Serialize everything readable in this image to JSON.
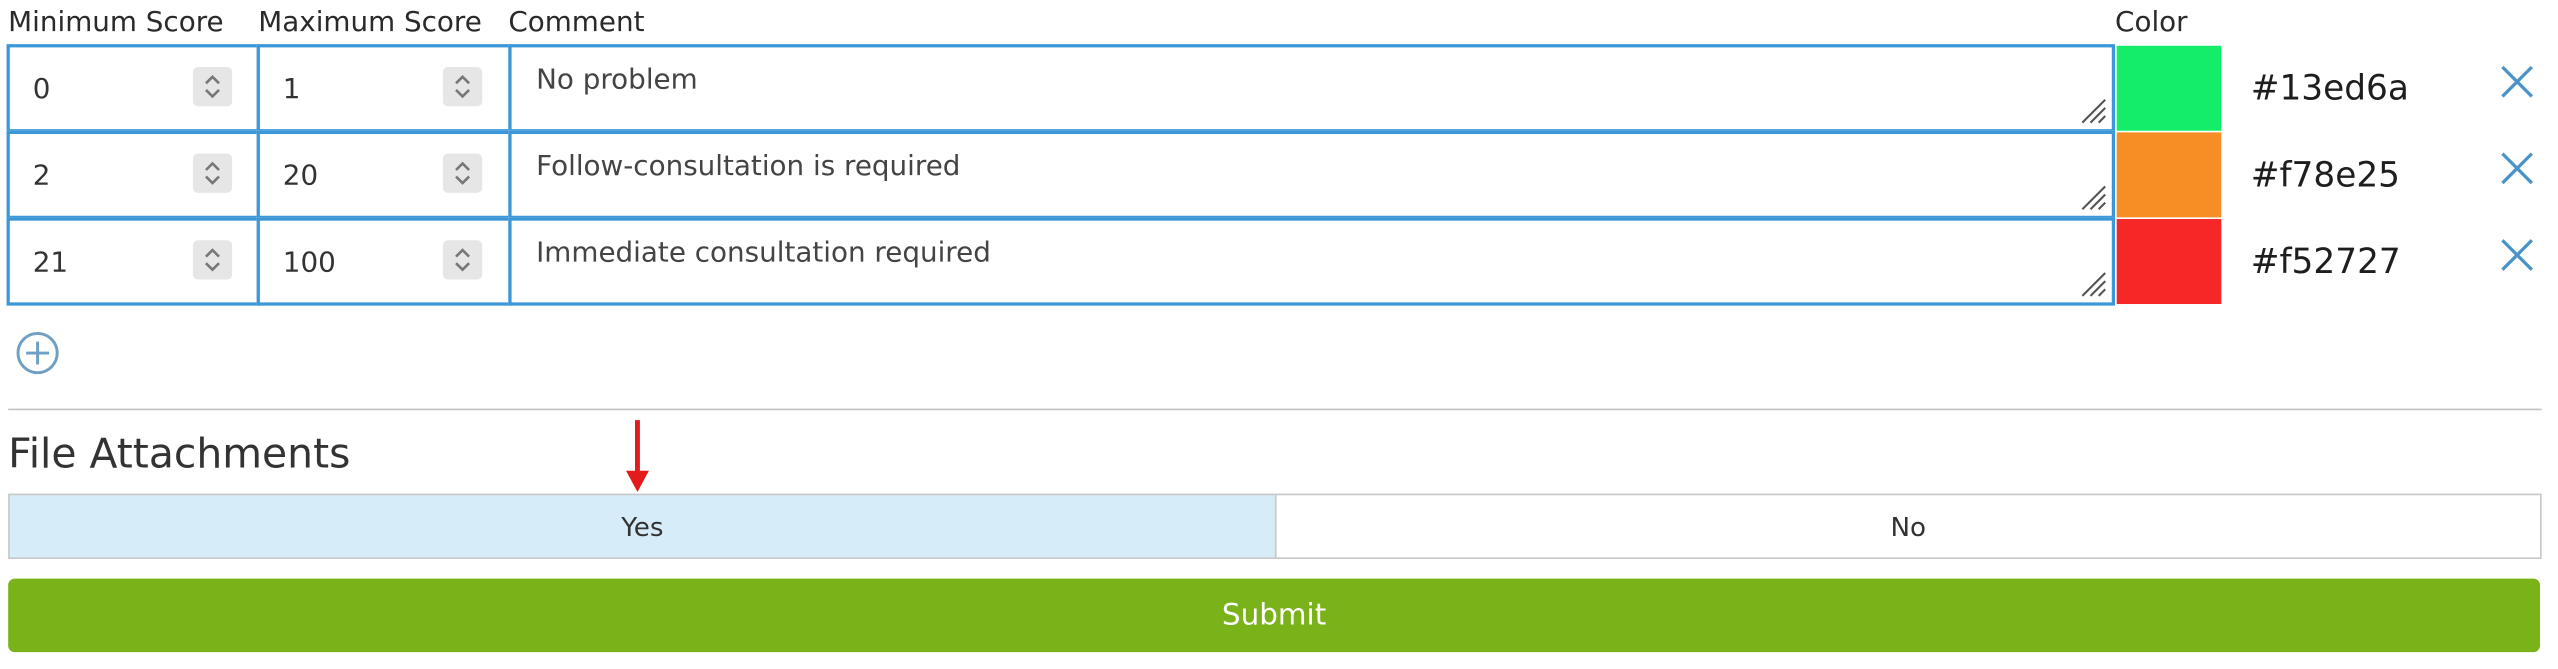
{
  "headers": {
    "min_score": "Minimum Score",
    "max_score": "Maximum Score",
    "comment": "Comment",
    "color": "Color"
  },
  "rows": [
    {
      "min": "0",
      "max": "1",
      "comment": "No problem",
      "color_hex": "#13ed6a"
    },
    {
      "min": "2",
      "max": "20",
      "comment": "Follow-consultation is required",
      "color_hex": "#f78e25"
    },
    {
      "min": "21",
      "max": "100",
      "comment": "Immediate consultation required",
      "color_hex": "#f52727"
    }
  ],
  "file_attachments": {
    "title": "File Attachments",
    "options": [
      "Yes",
      "No"
    ],
    "selected": "Yes"
  },
  "submit_label": "Submit",
  "colors": {
    "input_border": "#3c97d8",
    "selected_option_bg": "#d6ecf8",
    "submit_bg": "#7ab319",
    "close_icon": "#4a93c8",
    "add_icon": "#6fa0c4",
    "annotation_arrow": "#e31b1b"
  },
  "icons": {
    "spinner": "up-down-chevron-icon",
    "resize": "resize-grip-icon",
    "remove": "close-icon",
    "add": "plus-circle-icon",
    "annotation": "red-down-arrow-icon"
  }
}
